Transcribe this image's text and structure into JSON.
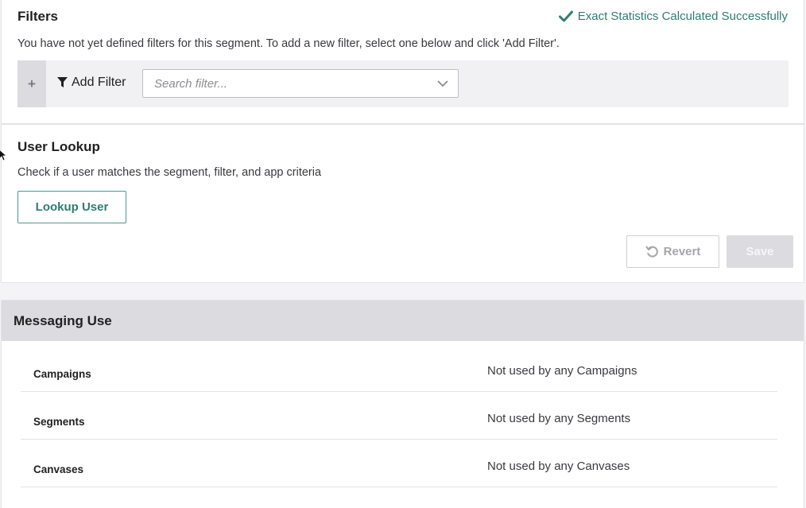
{
  "filters": {
    "title": "Filters",
    "status_text": "Exact Statistics Calculated Successfully",
    "description": "You have not yet defined filters for this segment. To add a new filter, select one below and click 'Add Filter'.",
    "add_filter_label": "Add Filter",
    "search_placeholder": "Search filter..."
  },
  "lookup": {
    "title": "User Lookup",
    "description": "Check if a user matches the segment, filter, and app criteria",
    "lookup_button": "Lookup User",
    "revert_button": "Revert",
    "save_button": "Save"
  },
  "messaging": {
    "title": "Messaging Use",
    "rows": [
      {
        "label": "Campaigns",
        "value": "Not used by any Campaigns"
      },
      {
        "label": "Segments",
        "value": "Not used by any Segments"
      },
      {
        "label": "Canvases",
        "value": "Not used by any Canvases"
      }
    ]
  },
  "colors": {
    "accent": "#2e7d73",
    "header_bg": "#dcdce0",
    "filter_bar_bg": "#f1f1f4"
  },
  "icons": [
    "plus-icon",
    "filter-funnel-icon",
    "chevron-down-icon",
    "checkmark-icon",
    "revert-icon",
    "mouse-cursor-icon"
  ]
}
